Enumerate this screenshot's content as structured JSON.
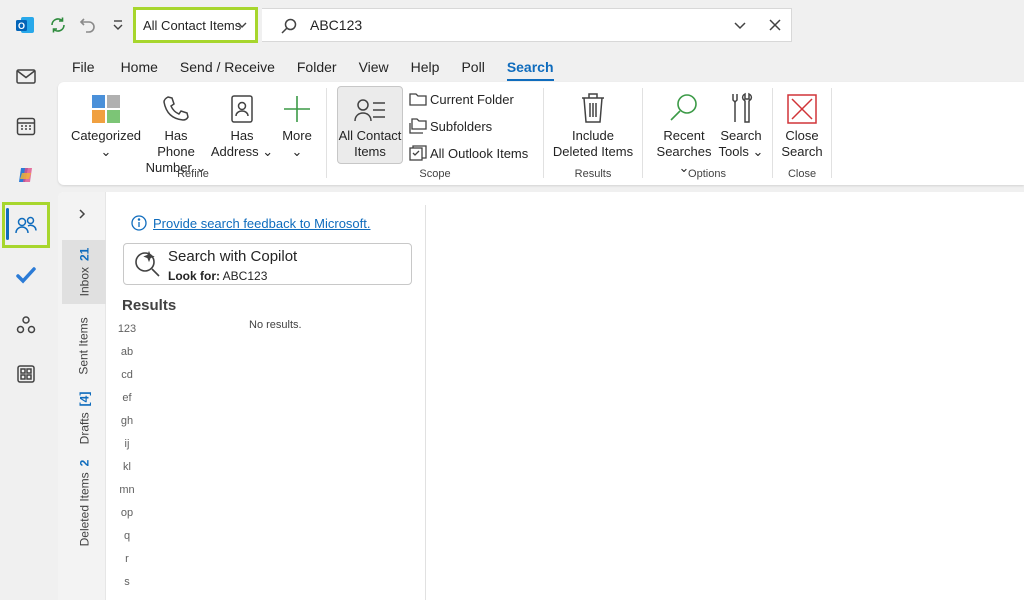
{
  "titlebar": {
    "scope_value": "All Contact Items",
    "search_value": "ABC123"
  },
  "tabs": [
    "File",
    "Home",
    "Send / Receive",
    "Folder",
    "View",
    "Help",
    "Poll",
    "Search"
  ],
  "active_tab": "Search",
  "ribbon": {
    "refine": {
      "label": "Refine",
      "categorized": [
        "Categorized",
        ""
      ],
      "has_phone": [
        "Has Phone",
        "Number"
      ],
      "has_address": [
        "Has",
        "Address"
      ],
      "more": [
        "More",
        ""
      ]
    },
    "scope": {
      "label": "Scope",
      "all_contact": [
        "All Contact",
        "Items"
      ],
      "current_folder": "Current Folder",
      "subfolders": "Subfolders",
      "all_outlook": "All Outlook Items"
    },
    "results": {
      "label": "Results",
      "include_deleted": [
        "Include",
        "Deleted Items"
      ]
    },
    "options": {
      "label": "Options",
      "recent": [
        "Recent",
        "Searches"
      ],
      "tools": [
        "Search",
        "Tools"
      ]
    },
    "close": {
      "label": "Close",
      "close_search": [
        "Close",
        "Search"
      ]
    }
  },
  "folders": [
    {
      "name": "Inbox",
      "count": "21"
    },
    {
      "name": "Sent Items",
      "count": ""
    },
    {
      "name": "Drafts",
      "count": "[4]"
    },
    {
      "name": "Deleted Items",
      "count": "2"
    }
  ],
  "main": {
    "feedback_link": "Provide search feedback to Microsoft.",
    "copilot_title": "Search with Copilot",
    "copilot_look_label": "Look for:",
    "copilot_look_value": "ABC123",
    "results_title": "Results",
    "no_results": "No results.",
    "index": [
      "123",
      "ab",
      "cd",
      "ef",
      "gh",
      "ij",
      "kl",
      "mn",
      "op",
      "q",
      "r",
      "s"
    ]
  },
  "colors": {
    "accent": "#0f6cbd",
    "highlight": "#a7d62d"
  }
}
